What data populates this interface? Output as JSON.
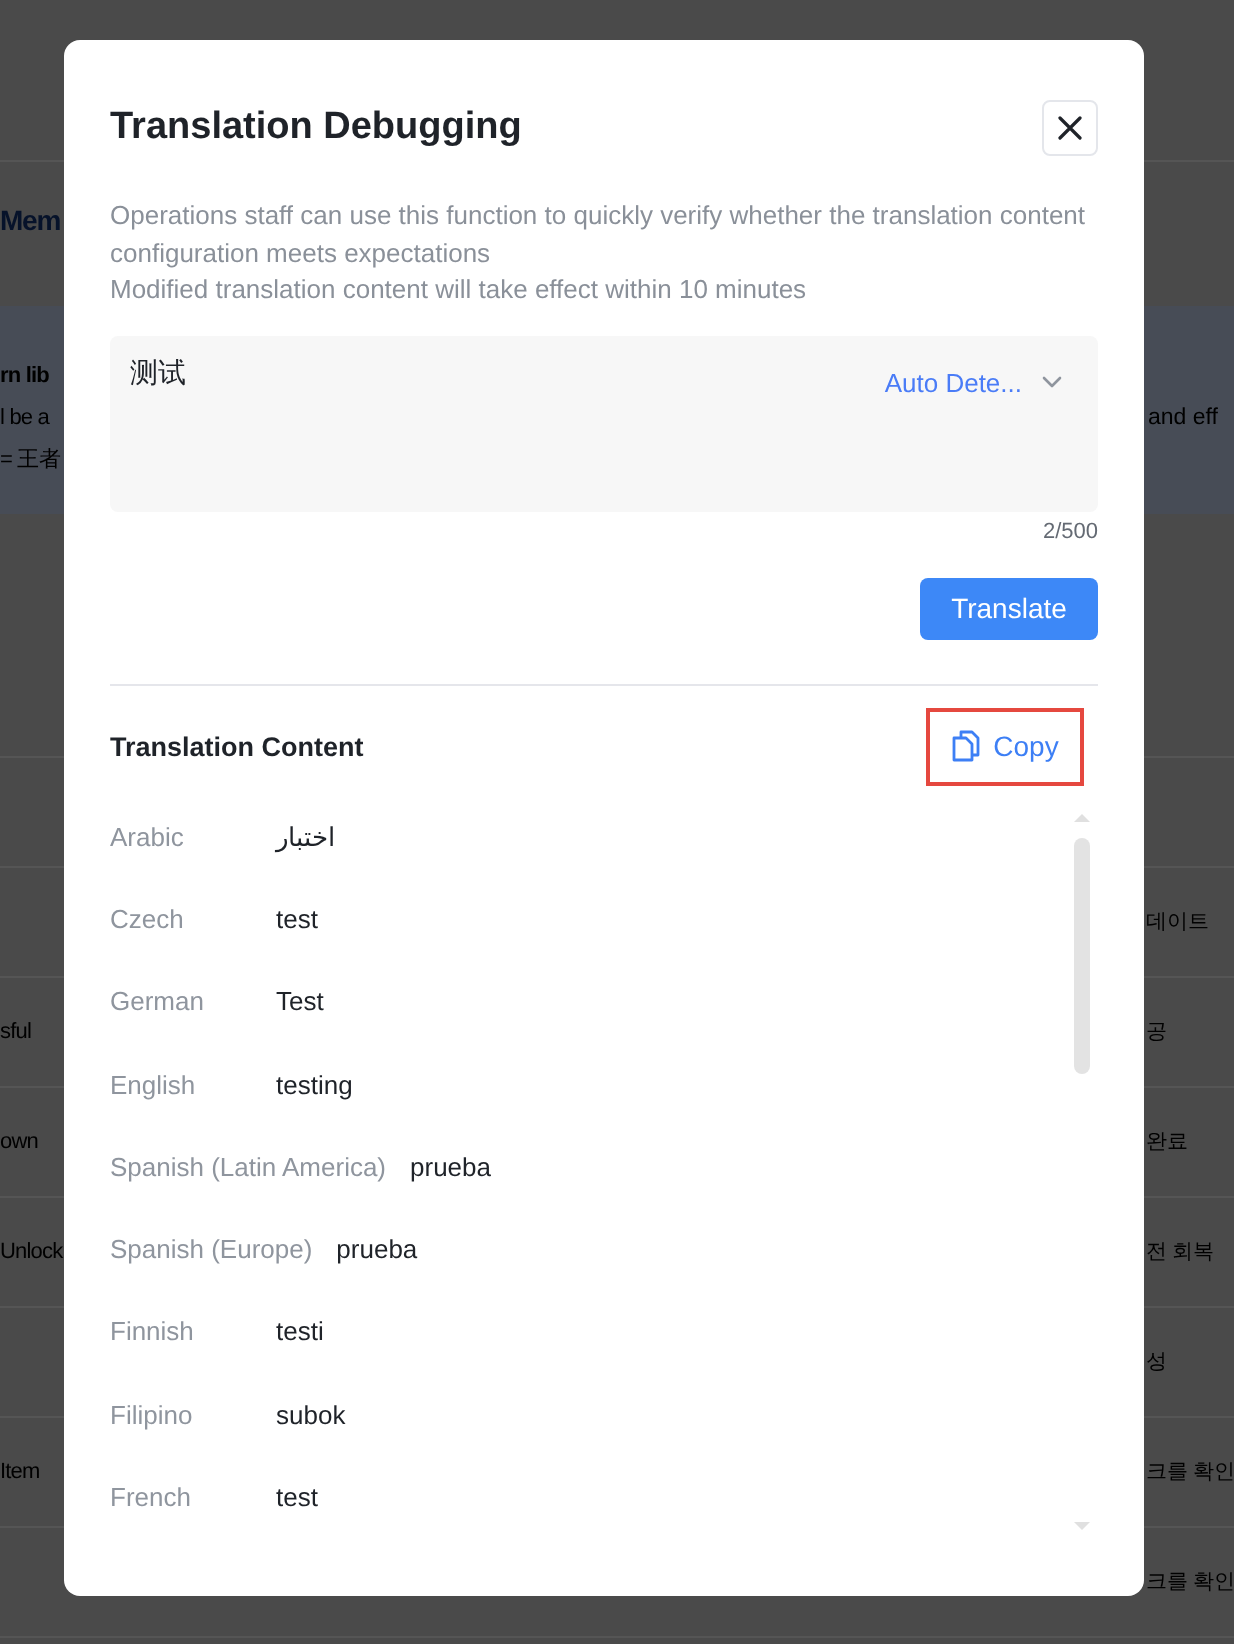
{
  "background_page": {
    "section_heading": "Mem",
    "notice_lines": [
      {
        "kind": "heading",
        "left": "rn lib"
      },
      {
        "kind": "body",
        "left": "l be a",
        "right": "and eff"
      },
      {
        "kind": "body",
        "left": "= 王者"
      }
    ],
    "rows": [
      {
        "right": "데이트"
      },
      {
        "left": "sful",
        "right": "공"
      },
      {
        "left": "own",
        "right": "완료"
      },
      {
        "left": "Unlock",
        "right": "전 회복"
      },
      {
        "right": "성"
      },
      {
        "left": "Item",
        "right": "크를 확인"
      },
      {
        "right": "크를 확인"
      }
    ]
  },
  "dialog": {
    "title": "Translation Debugging",
    "description": [
      "Operations staff can use this function to quickly verify whether the translation content configuration meets expectations",
      "Modified translation content will take effect within 10 minutes"
    ],
    "source": {
      "value": "测试",
      "language": "Auto Dete...",
      "counter": "2/500"
    },
    "translate_button": "Translate",
    "result": {
      "title": "Translation Content",
      "copy_button": {
        "label": "Copy",
        "highlighted": true
      },
      "rows": [
        {
          "language": "Arabic",
          "text": "اختبار"
        },
        {
          "language": "Czech",
          "text": "test"
        },
        {
          "language": "German",
          "text": "Test"
        },
        {
          "language": "English",
          "text": "testing"
        },
        {
          "language": "Spanish (Latin America)",
          "text": "prueba"
        },
        {
          "language": "Spanish (Europe)",
          "text": "prueba"
        },
        {
          "language": "Finnish",
          "text": "testi"
        },
        {
          "language": "Filipino",
          "text": "subok"
        },
        {
          "language": "French",
          "text": "test"
        }
      ]
    }
  }
}
